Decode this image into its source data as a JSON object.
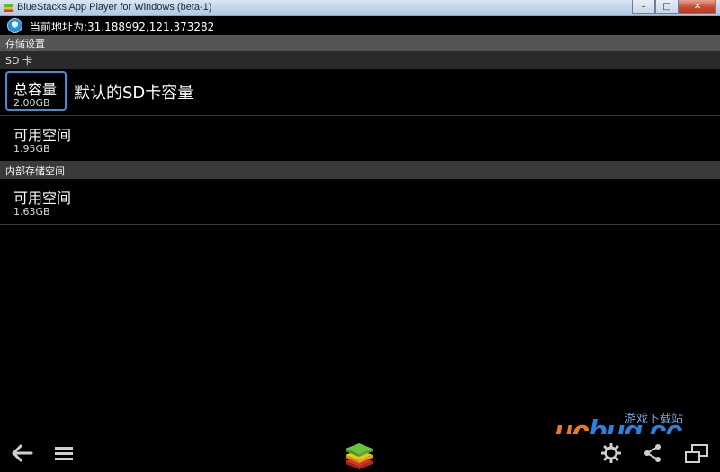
{
  "window": {
    "title": "BlueStacks App Player for Windows (beta-1)",
    "buttons": {
      "minimize": "–",
      "maximize": "□",
      "close": "✕"
    }
  },
  "location_bar": {
    "text": "当前地址为:31.188992,121.373282"
  },
  "storage": {
    "header": "存储设置",
    "sd_card": {
      "header": "SD 卡",
      "total": {
        "label": "总容量",
        "value": "2.00GB"
      },
      "tooltip": "默认的SD卡容量",
      "available": {
        "label": "可用空间",
        "value": "1.95GB"
      }
    },
    "internal": {
      "header": "内部存储空间",
      "available": {
        "label": "可用空间",
        "value": "1.63GB"
      }
    }
  },
  "watermark": {
    "brand_prefix": "uc",
    "brand_suffix": "bug.cc",
    "tagline": "游戏下载站"
  },
  "colors": {
    "focus_border": "#3f8fd9",
    "section_header_bg": "#555555",
    "watermark_orange": "#f07a1a",
    "watermark_blue": "#2d7fe0"
  }
}
